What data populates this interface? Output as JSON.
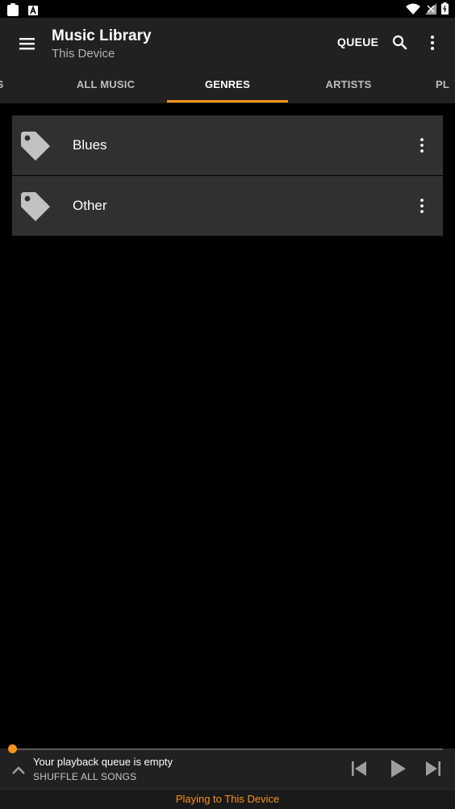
{
  "status_bar": {
    "left_icons": [
      "clipboard-icon",
      "a-letter-icon"
    ],
    "right_icons": [
      "wifi-icon",
      "signal-icon",
      "battery-icon"
    ]
  },
  "app_bar": {
    "title": "Music Library",
    "subtitle": "This Device",
    "queue_label": "QUEUE",
    "icons": [
      "menu-icon",
      "search-icon",
      "more-vert-icon"
    ]
  },
  "tabs": [
    {
      "label": "S",
      "active": false
    },
    {
      "label": "ALL MUSIC",
      "active": false
    },
    {
      "label": "GENRES",
      "active": true
    },
    {
      "label": "ARTISTS",
      "active": false
    },
    {
      "label": "PL",
      "active": false
    }
  ],
  "genres": [
    {
      "name": "Blues",
      "icon": "tag-icon"
    },
    {
      "name": "Other",
      "icon": "tag-icon"
    }
  ],
  "mini_player": {
    "status": "Your playback queue is empty",
    "shuffle_label": "SHUFFLE ALL SONGS",
    "progress": 0
  },
  "footer": {
    "playing_to": "Playing to This Device"
  },
  "colors": {
    "accent": "#f5931f",
    "app_bar": "#212121",
    "row": "#303030",
    "background": "#000000"
  }
}
